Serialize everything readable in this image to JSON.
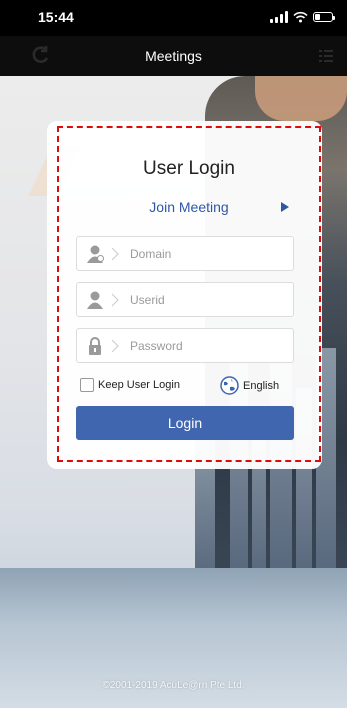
{
  "status_bar": {
    "time": "15:44",
    "icons": [
      "signal-icon",
      "wifi-icon",
      "battery-icon"
    ]
  },
  "nav": {
    "title": "Meetings",
    "left_icon": "refresh-icon",
    "right_icon": "menu-icon"
  },
  "login": {
    "title": "User Login",
    "join_meeting": "Join Meeting",
    "fields": [
      {
        "placeholder": "Domain",
        "icon": "domain-user-icon"
      },
      {
        "placeholder": "Userid",
        "icon": "user-icon"
      },
      {
        "placeholder": "Password",
        "icon": "lock-icon"
      }
    ],
    "keep_login_label": "Keep User Login",
    "keep_login_checked": false,
    "language": "English",
    "button_label": "Login"
  },
  "footer": {
    "copyright": "©2001-2019 AcuLe@rn Pte Ltd."
  },
  "colors": {
    "accent": "#4166b0",
    "link": "#2e58a6",
    "highlight_dash": "#e00a0a",
    "nav_bg": "#0d0d0d"
  }
}
